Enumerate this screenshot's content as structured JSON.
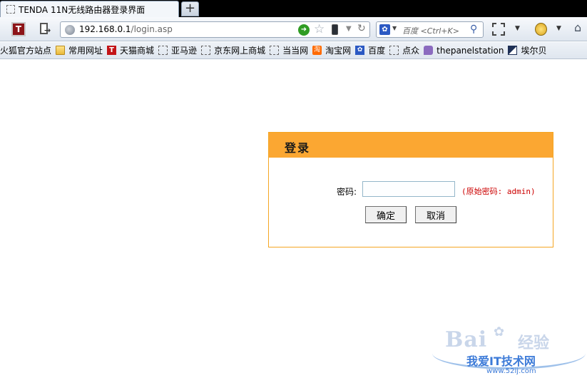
{
  "browser": {
    "tab_title": "TENDA 11N无线路由器登录界面",
    "new_tab_symbol": "+",
    "url_host": "192.168.0.1",
    "url_path": "/login.asp",
    "search_placeholder": "百度 <Ctrl+K>"
  },
  "bookmarks": [
    {
      "label": "火狐官方站点",
      "icon": "dashed-page-icon"
    },
    {
      "label": "常用网址",
      "icon": "folder-icon"
    },
    {
      "label": "天猫商城",
      "icon": "tmall-icon"
    },
    {
      "label": "亚马逊",
      "icon": "dashed-page-icon"
    },
    {
      "label": "京东网上商城",
      "icon": "dashed-page-icon"
    },
    {
      "label": "当当网",
      "icon": "dashed-page-icon"
    },
    {
      "label": "淘宝网",
      "icon": "taobao-icon"
    },
    {
      "label": "百度",
      "icon": "baidu-paw-icon"
    },
    {
      "label": "点众",
      "icon": "dashed-page-icon"
    },
    {
      "label": "thepanelstation",
      "icon": "speech-bubble-icon"
    },
    {
      "label": "埃尔贝",
      "icon": "ae-logo-icon"
    }
  ],
  "login": {
    "title": "登录",
    "password_label": "密码:",
    "password_value": "",
    "hint": "(原始密码: admin)",
    "ok_label": "确定",
    "cancel_label": "取消"
  },
  "colors": {
    "header_orange": "#fba732",
    "hint_red": "#cc0000"
  },
  "watermark": {
    "logo_text": "Bai",
    "logo_suffix": "经验",
    "tagline": "我爱IT技术网",
    "url": "www.52ij.com"
  }
}
